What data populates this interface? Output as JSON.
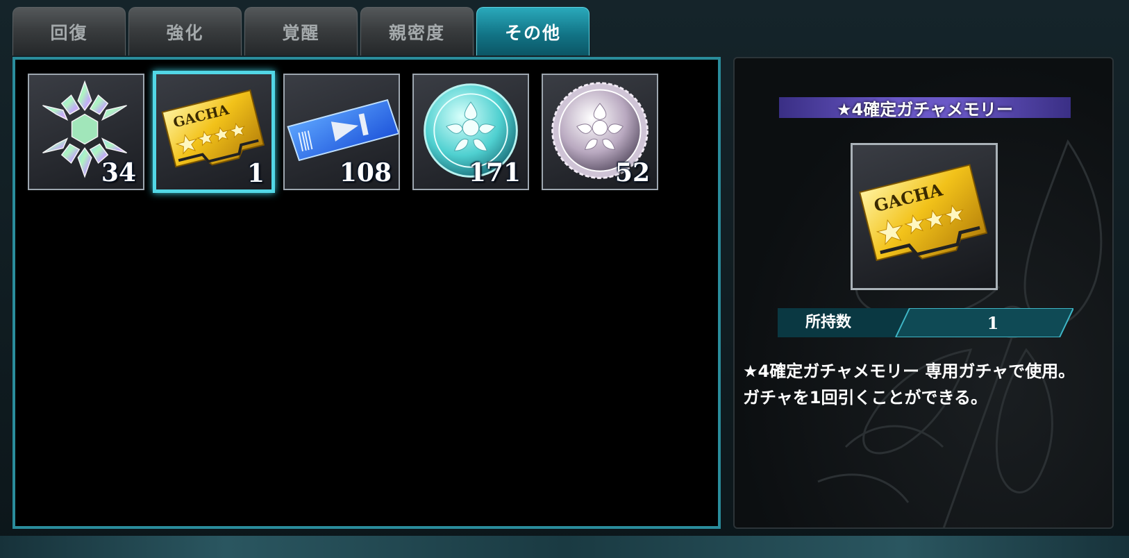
{
  "tabs": [
    {
      "label": "回復",
      "active": false
    },
    {
      "label": "強化",
      "active": false
    },
    {
      "label": "覚醒",
      "active": false
    },
    {
      "label": "親密度",
      "active": false
    },
    {
      "label": "その他",
      "active": true
    }
  ],
  "items": [
    {
      "icon": "rainbow-crystal-icon",
      "count": "34"
    },
    {
      "icon": "gacha-card-icon",
      "count": "1",
      "selected": true
    },
    {
      "icon": "skip-ticket-icon",
      "count": "108"
    },
    {
      "icon": "teal-medal-icon",
      "count": "171"
    },
    {
      "icon": "silver-medal-icon",
      "count": "52"
    }
  ],
  "detail": {
    "name": "★4確定ガチャメモリー",
    "icon": "gacha-card-icon",
    "card_text": "GACHA",
    "owned_label": "所持数",
    "owned_value": "1",
    "description": "★4確定ガチャメモリー 専用ガチャで使用。ガチャを1回引くことができる。"
  },
  "colors": {
    "accent": "#2a8c9b",
    "active_tab": "#1a8fa1",
    "name_banner": "#6a58c7"
  }
}
